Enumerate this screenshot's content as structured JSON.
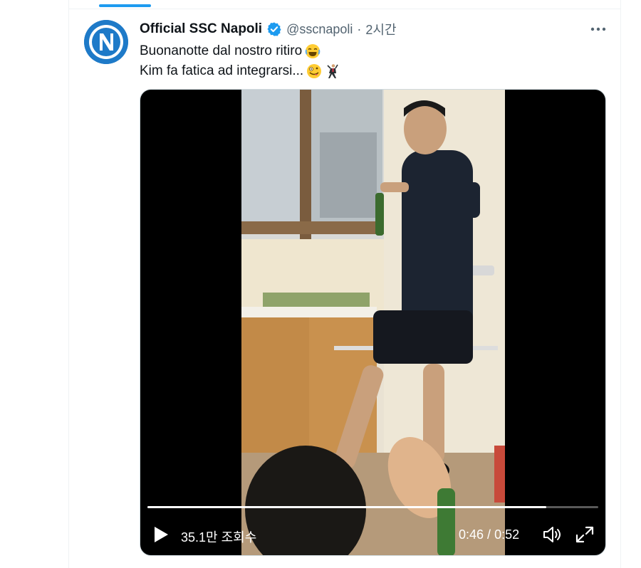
{
  "tweet": {
    "author_name": "Official SSC Napoli",
    "handle": "@sscnapoli",
    "separator": "·",
    "timestamp": "2시간",
    "verified": true,
    "lines": [
      "Buonanotte dal nostro ritiro",
      "Kim fa fatica ad integrarsi..."
    ],
    "emojis": [
      "face-with-tears-of-joy-emoji",
      "zany-face-emoji",
      "man-dancing-emoji"
    ],
    "more_icon": "more-horizontal-icon"
  },
  "avatar": {
    "letter": "N",
    "colors": {
      "outer": "#1e7ac8",
      "ring": "#ffffff",
      "inner": "#1e7ac8"
    }
  },
  "video": {
    "views": "35.1만 조회수",
    "current_time": "0:46",
    "time_separator": " / ",
    "duration": "0:52",
    "progress_fraction": 0.885,
    "icons": [
      "play-icon",
      "volume-icon",
      "fullscreen-icon"
    ]
  },
  "colors": {
    "accent": "#1d9bf0",
    "text_primary": "#0f1419",
    "text_secondary": "#536471",
    "divider": "#eff3f4"
  }
}
